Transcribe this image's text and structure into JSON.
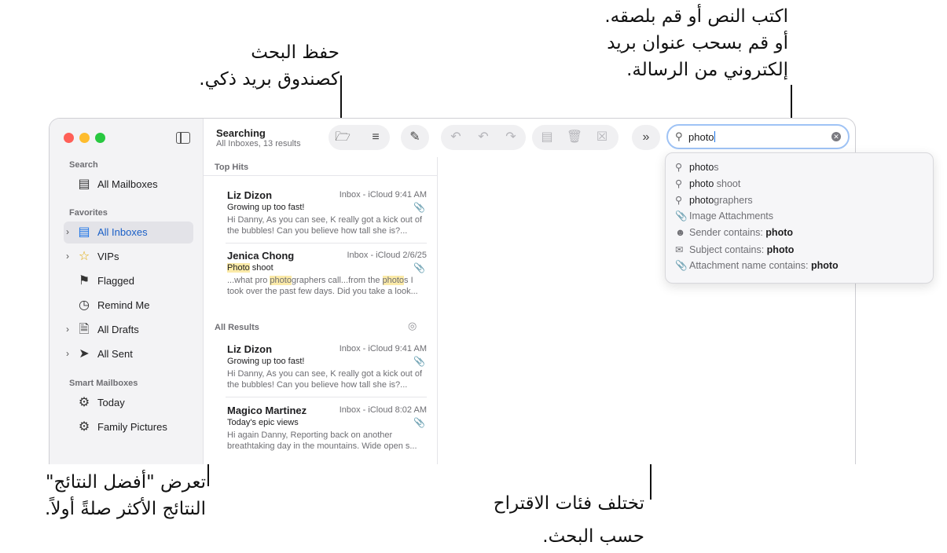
{
  "callouts": {
    "type_text": [
      "اكتب النص أو قم بلصقه.",
      "أو قم بسحب عنوان بريد",
      "إلكتروني من الرسالة."
    ],
    "save_search": [
      "حفظ البحث",
      "كصندوق بريد ذكي."
    ],
    "top_hits": [
      "تعرض \"أفضل النتائج\"",
      "النتائج الأكثر صلةً أولاً."
    ],
    "suggestion_categories": [
      "تختلف فئات الاقتراح",
      "حسب البحث."
    ]
  },
  "toolbar": {
    "title": "Searching",
    "subtitle": "All Inboxes, 13 results",
    "icons": [
      "new-smart-mailbox-icon",
      "filter-icon",
      "compose-icon",
      "reply-icon",
      "reply-all-icon",
      "forward-icon",
      "archive-icon",
      "trash-icon",
      "junk-icon",
      "more-icon"
    ]
  },
  "sidebar": {
    "sections": {
      "search": "Search",
      "favorites": "Favorites",
      "smart": "Smart Mailboxes"
    },
    "items": [
      {
        "label": "All Mailboxes"
      },
      {
        "label": "All Inboxes"
      },
      {
        "label": "VIPs"
      },
      {
        "label": "Flagged"
      },
      {
        "label": "Remind Me"
      },
      {
        "label": "All Drafts"
      },
      {
        "label": "All Sent"
      },
      {
        "label": "Today"
      },
      {
        "label": "Family Pictures"
      }
    ]
  },
  "search": {
    "value": "photo"
  },
  "list": {
    "top_hits_label": "Top Hits",
    "all_results_label": "All Results",
    "messages": [
      {
        "from": "Liz Dizon",
        "meta": "Inbox - iCloud   9:41 AM",
        "subject": "Growing up too fast!",
        "preview": "Hi Danny, As you can see, K really got a kick out of the bubbles! Can you believe how tall she is?..."
      },
      {
        "from": "Jenica Chong",
        "meta": "Inbox - iCloud   2/6/25",
        "subject_hl": "Photo",
        "subject_rest": " shoot",
        "p1": "...what pro ",
        "p1_hl": "photo",
        "p2": "graphers call...from the ",
        "p2_hl": "photo",
        "p3": "s I took over the past few days. Did you take a look..."
      },
      {
        "from": "Liz Dizon",
        "meta": "Inbox - iCloud   9:41 AM",
        "subject": "Growing up too fast!",
        "preview": "Hi Danny, As you can see, K really got a kick out of the bubbles! Can you believe how tall she is?..."
      },
      {
        "from": "Magico Martinez",
        "meta": "Inbox - iCloud   8:02 AM",
        "subject": "Today's epic views",
        "preview": "Hi again Danny, Reporting back on another breathtaking day in the mountains. Wide open s..."
      }
    ]
  },
  "suggestions": [
    {
      "bold": "photo",
      "rest": "s"
    },
    {
      "bold": "photo",
      "rest": " shoot"
    },
    {
      "bold": "photo",
      "rest": "graphers"
    },
    {
      "label": "Image Attachments"
    },
    {
      "label": "Sender contains: ",
      "value": "photo"
    },
    {
      "label": "Subject contains: ",
      "value": "photo"
    },
    {
      "label": "Attachment name contains: ",
      "value": "photo"
    }
  ]
}
